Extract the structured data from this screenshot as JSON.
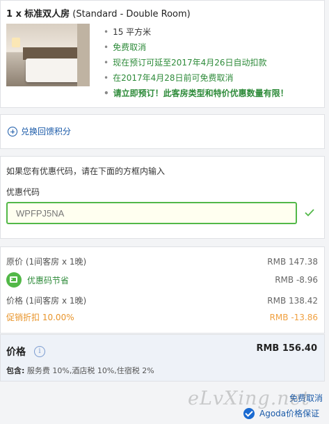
{
  "room": {
    "qty": "1 x",
    "name_cn": "标准双人房",
    "name_en": "(Standard - Double Room)",
    "features": [
      {
        "text": "15 平方米",
        "style": "plain"
      },
      {
        "text": "免费取消",
        "style": "green"
      },
      {
        "text": "现在预订可延至2017年4月26日自动扣款",
        "style": "green"
      },
      {
        "text": "在2017年4月28日前可免费取消",
        "style": "green"
      },
      {
        "text": "请立即预订！此客房类型和特价优惠数量有限！",
        "style": "bold-green"
      }
    ]
  },
  "points": {
    "label": "兑换回馈积分"
  },
  "promo": {
    "hint": "如果您有优惠代码，请在下面的方框内输入",
    "label": "优惠代码",
    "value": "WPFPJ5NA"
  },
  "breakdown": {
    "original_label": "原价 (1间客房 x 1晚)",
    "original_value": "RMB 147.38",
    "coupon_label": "优惠码节省",
    "coupon_value": "RMB -8.96",
    "price_label": "价格 (1间客房 x 1晚)",
    "price_value": "RMB 138.42",
    "promo_label": "促销折扣",
    "promo_pct": "10.00%",
    "promo_value": "RMB -13.86"
  },
  "total": {
    "label": "价格",
    "value": "RMB 156.40",
    "includes_label": "包含:",
    "includes_text": "服务费 10%,酒店税 10%,住宿税 2%"
  },
  "footer": {
    "free_cancel": "免费取消",
    "guarantee": "Agoda价格保证"
  },
  "watermark": "eLvXing.net",
  "colors": {
    "green": "#2e8b3a",
    "link_blue": "#1a5aa8",
    "orange": "#e8942a",
    "input_border": "#52b848"
  }
}
